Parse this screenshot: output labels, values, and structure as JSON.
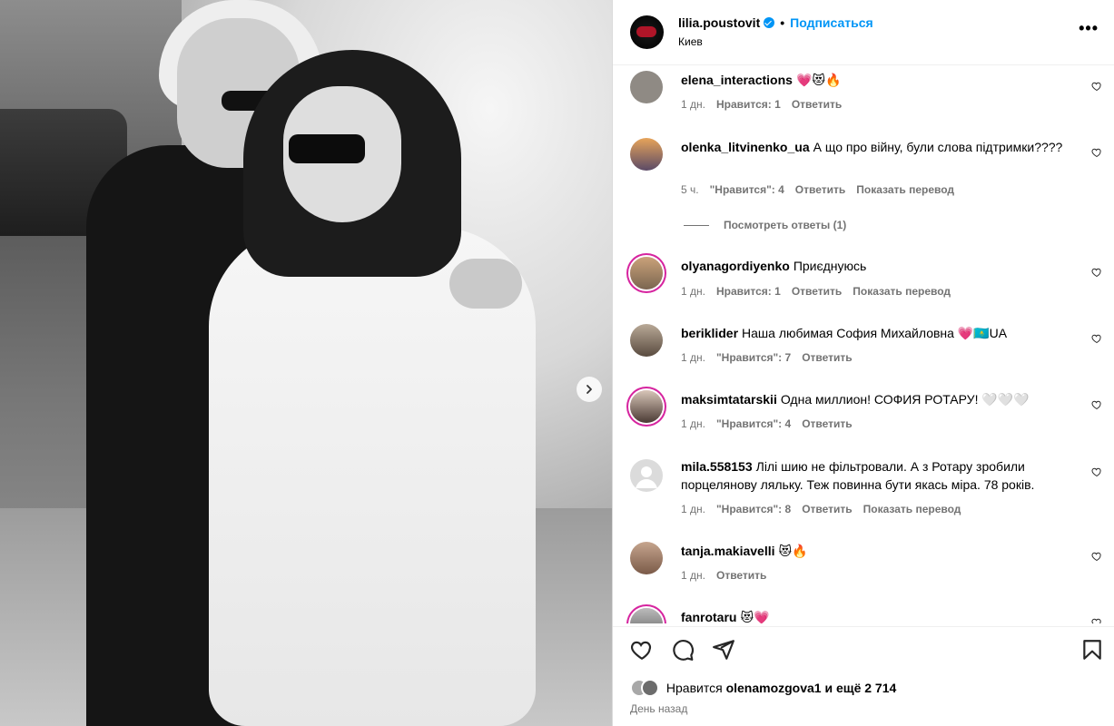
{
  "post": {
    "username": "lilia.poustovit",
    "subscribe_label": "Подписаться",
    "location": "Киев",
    "more_label": "•••"
  },
  "comments": [
    {
      "user": "elena_interactions",
      "text": "💗😻🔥",
      "time": "1 дн.",
      "likes": "Нравится: 1",
      "reply": "Ответить",
      "translate": ""
    },
    {
      "user": "olenka_litvinenko_ua",
      "text": "А що про війну, були слова підтримки????",
      "time": "5 ч.",
      "likes": "\"Нравится\": 4",
      "reply": "Ответить",
      "translate": "Показать перевод"
    },
    {
      "user": "olyanagordiyenko",
      "text": "Приєднуюсь",
      "time": "1 дн.",
      "likes": "Нравится: 1",
      "reply": "Ответить",
      "translate": "Показать перевод"
    },
    {
      "user": "beriklider",
      "text": "Наша любимая София Михайловна 💗🇰🇿UA",
      "time": "1 дн.",
      "likes": "\"Нравится\": 7",
      "reply": "Ответить",
      "translate": ""
    },
    {
      "user": "maksimtatarskii",
      "text": "Одна миллион! СОФИЯ РОТАРУ! 🤍🤍🤍",
      "time": "1 дн.",
      "likes": "\"Нравится\": 4",
      "reply": "Ответить",
      "translate": ""
    },
    {
      "user": "mila.558153",
      "text": "Лілі шию не фільтровали. А з Ротару зробили порцелянову ляльку. Теж повинна бути якась міра. 78 років.",
      "time": "1 дн.",
      "likes": "\"Нравится\": 8",
      "reply": "Ответить",
      "translate": "Показать перевод"
    },
    {
      "user": "tanja.makiavelli",
      "text": "😻🔥",
      "time": "1 дн.",
      "likes": "",
      "reply": "Ответить",
      "translate": ""
    },
    {
      "user": "fanrotaru",
      "text": "😻💗",
      "time": "",
      "likes": "",
      "reply": "",
      "translate": ""
    }
  ],
  "view_replies": "Посмотреть ответы (1)",
  "likes_bar": {
    "prefix": "Нравится",
    "user": "olenamozgova1",
    "suffix": "и ещё 2 714"
  },
  "date": "День назад",
  "icons": [
    "like-icon",
    "comment-icon",
    "share-icon",
    "save-icon",
    "next-arrow-icon",
    "verified-icon"
  ]
}
